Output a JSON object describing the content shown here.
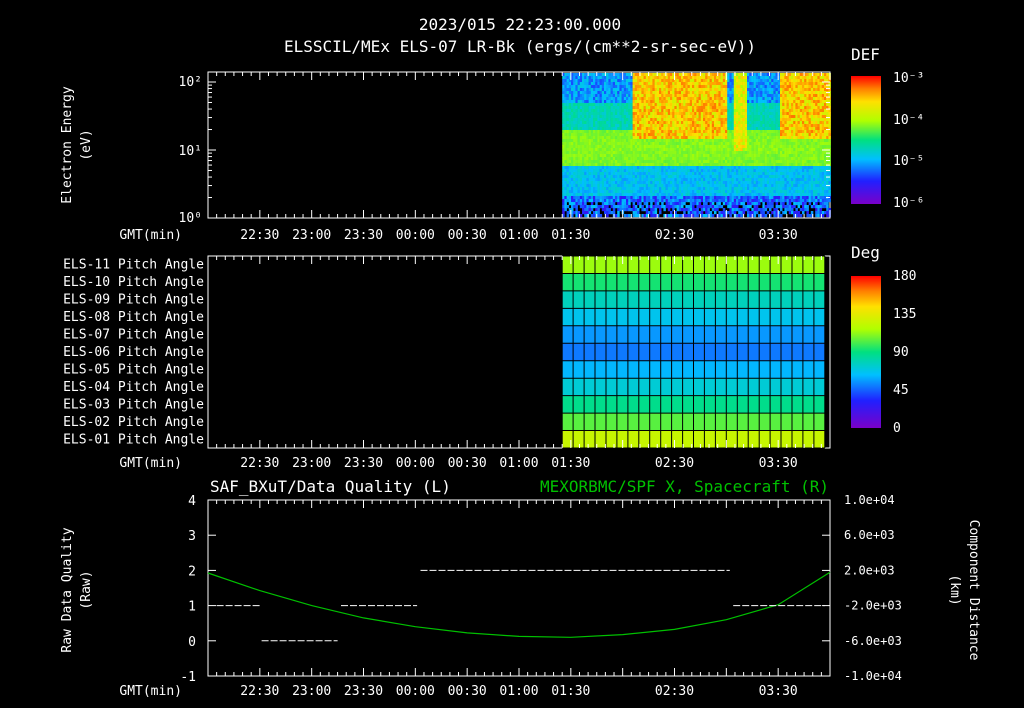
{
  "header": {
    "time": "2023/015 22:23:00.000",
    "subtitle": "ELSSCIL/MEx ELS-07 LR-Bk  (ergs/(cm**2-sr-sec-eV))"
  },
  "time_axis": {
    "label": "GMT(min)",
    "ticks": [
      "22:30",
      "23:00",
      "23:30",
      "00:00",
      "00:30",
      "01:00",
      "01:30",
      "02:30",
      "03:30"
    ],
    "tick_minutes": [
      30,
      60,
      90,
      120,
      150,
      180,
      210,
      270,
      330
    ],
    "range_minutes": [
      0,
      360
    ]
  },
  "colors": {
    "background": "#000000",
    "axis": "#ffffff",
    "right_series": "#00c000",
    "colormap": [
      "#7a00c8",
      "#2020ff",
      "#00c0ff",
      "#00e080",
      "#b0ff00",
      "#ffe000",
      "#ff8000",
      "#ff0000"
    ]
  },
  "spectrogram": {
    "ylabel_line1": "Electron Energy",
    "ylabel_line2": "(eV)",
    "ytick_labels": [
      "10²",
      "10¹",
      "10⁰"
    ],
    "colorbar_title": "DEF",
    "colorbar_ticks": [
      "10⁻³",
      "10⁻⁴",
      "10⁻⁵",
      "10⁻⁶"
    ],
    "data_start_minute": 205
  },
  "pitch": {
    "rows": [
      "ELS-11 Pitch Angle",
      "ELS-10 Pitch Angle",
      "ELS-09 Pitch Angle",
      "ELS-08 Pitch Angle",
      "ELS-07 Pitch Angle",
      "ELS-06 Pitch Angle",
      "ELS-05 Pitch Angle",
      "ELS-04 Pitch Angle",
      "ELS-03 Pitch Angle",
      "ELS-02 Pitch Angle",
      "ELS-01 Pitch Angle"
    ],
    "row_values_deg": [
      100,
      80,
      65,
      55,
      45,
      40,
      50,
      60,
      75,
      90,
      110
    ],
    "colorbar_title": "Deg",
    "colorbar_ticks": [
      "180",
      "135",
      "90",
      "45",
      "0"
    ],
    "data_start_minute": 205,
    "data_end_minute": 357
  },
  "chart_data": {
    "type": "line",
    "title_left": "SAF_BXuT/Data Quality (L)",
    "title_right": "MEXORBMC/SPF X, Spacecraft (R)",
    "ylabel_left_line1": "Raw Data Quality",
    "ylabel_left_line2": "(Raw)",
    "ylabel_right_line1": "Component Distance",
    "ylabel_right_line2": "(km)",
    "ylim_left": [
      -1,
      4
    ],
    "ytick_left": [
      "4",
      "3",
      "2",
      "1",
      "0",
      "-1"
    ],
    "ylim_right": [
      -10000,
      10000
    ],
    "ytick_right": [
      "1.0e+04",
      "6.0e+03",
      "2.0e+03",
      "-2.0e+03",
      "-6.0e+03",
      "-1.0e+04"
    ],
    "quality_segments": [
      {
        "start": 5,
        "end": 30,
        "value": 1
      },
      {
        "start": 31,
        "end": 75,
        "value": 0
      },
      {
        "start": 77,
        "end": 121,
        "value": 1
      },
      {
        "start": 123,
        "end": 302,
        "value": 2
      },
      {
        "start": 304,
        "end": 357,
        "value": 1
      }
    ],
    "spf_x": {
      "minutes": [
        0,
        30,
        60,
        90,
        120,
        150,
        180,
        210,
        240,
        270,
        300,
        330,
        360
      ],
      "km": [
        1700,
        -300,
        -2000,
        -3400,
        -4400,
        -5100,
        -5500,
        -5600,
        -5300,
        -4700,
        -3600,
        -1900,
        1800
      ]
    }
  }
}
